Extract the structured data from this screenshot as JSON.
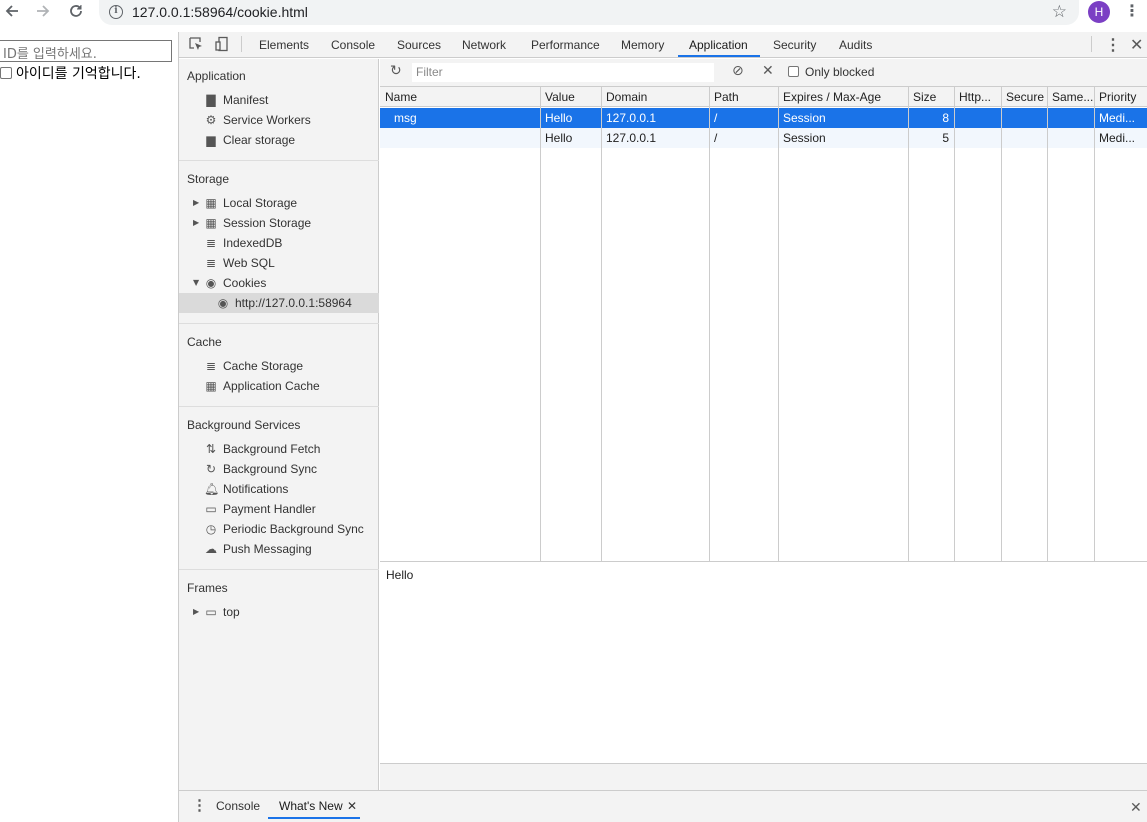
{
  "browser": {
    "url": "127.0.0.1:58964/cookie.html",
    "avatar_letter": "H"
  },
  "page": {
    "id_placeholder": "ID를 입력하세요.",
    "remember_label": "아이디를 기억합니다."
  },
  "devtools": {
    "tabs": [
      "Elements",
      "Console",
      "Sources",
      "Network",
      "Performance",
      "Memory",
      "Application",
      "Security",
      "Audits"
    ],
    "active_tab": "Application",
    "sidebar": {
      "application_heading": "Application",
      "application_items": [
        "Manifest",
        "Service Workers",
        "Clear storage"
      ],
      "storage_heading": "Storage",
      "storage_items": [
        "Local Storage",
        "Session Storage",
        "IndexedDB",
        "Web SQL",
        "Cookies"
      ],
      "cookie_origin": "http://127.0.0.1:58964",
      "cache_heading": "Cache",
      "cache_items": [
        "Cache Storage",
        "Application Cache"
      ],
      "background_heading": "Background Services",
      "background_items": [
        "Background Fetch",
        "Background Sync",
        "Notifications",
        "Payment Handler",
        "Periodic Background Sync",
        "Push Messaging"
      ],
      "frames_heading": "Frames",
      "frames_items": [
        "top"
      ]
    },
    "toolbar": {
      "filter_placeholder": "Filter",
      "only_blocked_label": "Only blocked"
    },
    "cookie_table": {
      "columns": [
        "Name",
        "Value",
        "Domain",
        "Path",
        "Expires / Max-Age",
        "Size",
        "Http...",
        "Secure",
        "Same...",
        "Priority"
      ],
      "rows": [
        {
          "name": "msg",
          "value": "Hello",
          "domain": "127.0.0.1",
          "path": "/",
          "expires": "Session",
          "size": "8",
          "http": "",
          "secure": "",
          "same": "",
          "priority": "Medi..."
        },
        {
          "name": "",
          "value": "Hello",
          "domain": "127.0.0.1",
          "path": "/",
          "expires": "Session",
          "size": "5",
          "http": "",
          "secure": "",
          "same": "",
          "priority": "Medi..."
        }
      ],
      "selected_row": 0
    },
    "preview_value": "Hello",
    "drawer": {
      "tabs": [
        "Console",
        "What's New"
      ],
      "active_tab": "What's New"
    }
  },
  "colors": {
    "accent": "#1a73e8",
    "avatar_bg": "#7b3fc4"
  }
}
